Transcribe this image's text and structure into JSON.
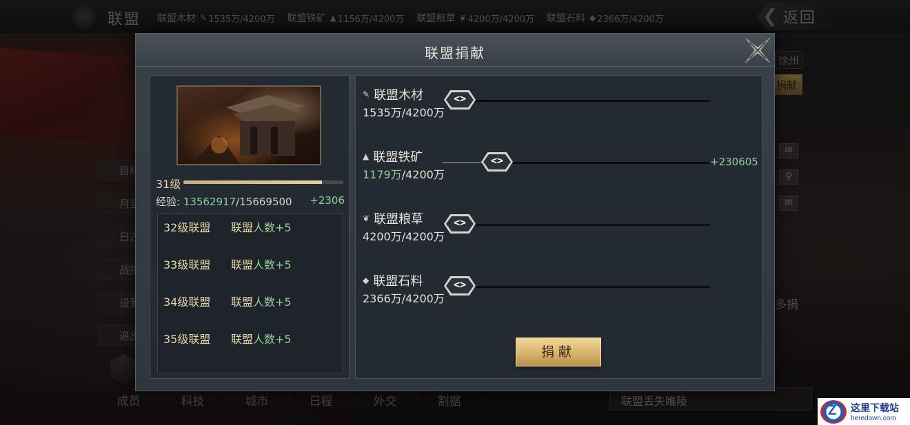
{
  "topbar": {
    "title": "联盟",
    "resources": [
      {
        "label": "联盟木材",
        "icon": "wood-icon",
        "value": "1535万/4200万"
      },
      {
        "label": "联盟铁矿",
        "icon": "iron-icon",
        "value": "1156万/4200万"
      },
      {
        "label": "联盟粮草",
        "icon": "grain-icon",
        "value": "4200万/4200万"
      },
      {
        "label": "联盟石料",
        "icon": "stone-icon",
        "value": "2366万/4200万"
      }
    ],
    "back_label": "返回"
  },
  "background": {
    "side_menu": [
      "目标",
      "月旦",
      "日志",
      "战报",
      "设置",
      "退出"
    ],
    "bottom_tabs": [
      "成员",
      "科技",
      "城市",
      "日程",
      "外交",
      "割据"
    ],
    "right_city": "徐州",
    "right_donate": "捐献",
    "right_more": "多捐",
    "lost_notice": "联盟丢失睢陵"
  },
  "modal": {
    "title": "联盟捐献",
    "left": {
      "level_label": "31级",
      "level_progress": 0.865,
      "exp_label": "经验:",
      "exp_current": "13562917",
      "exp_total": "/15669500",
      "exp_gain": "+2306",
      "unlocks": [
        {
          "level": "32级联盟",
          "prefix": "联盟",
          "benefit": "人数+5"
        },
        {
          "level": "33级联盟",
          "prefix": "联盟",
          "benefit": "人数+5"
        },
        {
          "level": "34级联盟",
          "prefix": "联盟",
          "benefit": "人数+5"
        },
        {
          "level": "35级联盟",
          "prefix": "联盟",
          "benefit": "人数+5"
        }
      ]
    },
    "resources": [
      {
        "name": "联盟木材",
        "icon": "wood-icon",
        "current": "1535万",
        "total": "/4200万",
        "gain": "",
        "slider_value": 0
      },
      {
        "name": "联盟铁矿",
        "icon": "iron-icon",
        "current": "1179万",
        "total": "/4200万",
        "gain": "+230605",
        "slider_value": 0.15
      },
      {
        "name": "联盟粮草",
        "icon": "grain-icon",
        "current": "4200万",
        "total": "/4200万",
        "gain": "",
        "slider_value": 0
      },
      {
        "name": "联盟石料",
        "icon": "stone-icon",
        "current": "2366万",
        "total": "/4200万",
        "gain": "",
        "slider_value": 0
      }
    ],
    "slider_handle_glyph": "<>",
    "donate_button": "捐献"
  },
  "watermark": {
    "cn": "这里下载站",
    "en": "heredown.com"
  },
  "colors": {
    "accent_green": "#8fcf9a",
    "gold_button": "#d8b36c",
    "panel_bg": "#242a31"
  }
}
